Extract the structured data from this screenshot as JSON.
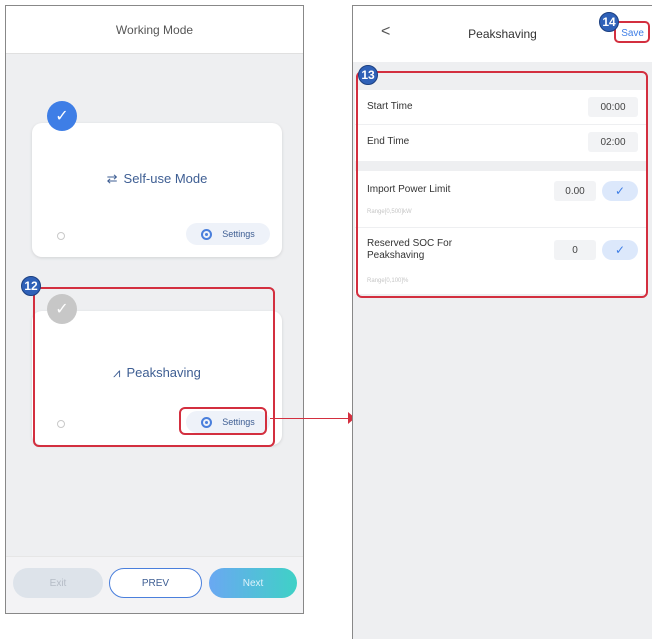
{
  "left": {
    "title": "Working Mode",
    "cards": [
      {
        "label": "Self-use Mode",
        "settings": "Settings",
        "selected": true
      },
      {
        "label": "Peakshaving",
        "settings": "Settings",
        "selected": false
      }
    ],
    "footer": {
      "exit": "Exit",
      "prev": "PREV",
      "next": "Next"
    }
  },
  "right": {
    "title": "Peakshaving",
    "back": "<",
    "save": "Save",
    "start_time": {
      "label": "Start Time",
      "value": "00:00"
    },
    "end_time": {
      "label": "End Time",
      "value": "02:00"
    },
    "import_limit": {
      "label": "Import Power Limit",
      "value": "0.00",
      "range": "Range[0,500]kW"
    },
    "reserved_soc": {
      "label": "Reserved SOC For Peakshaving",
      "value": "0",
      "range": "Range[0,100]%"
    }
  },
  "annotations": {
    "n12": "12",
    "n13": "13",
    "n14": "14"
  },
  "colors": {
    "accent": "#3e7ee6",
    "annotation": "#d32f3f",
    "badge": "#2f61b8"
  }
}
